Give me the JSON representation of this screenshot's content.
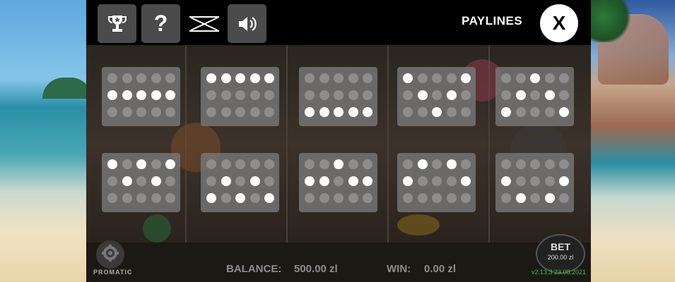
{
  "toolbar": {
    "trophy_icon": "trophy-icon",
    "help_label": "?",
    "turbo_icon": "turbo-off-icon",
    "sound_icon": "speaker-icon"
  },
  "panel": {
    "title": "PAYLINES",
    "close_label": "X"
  },
  "paylines": [
    {
      "rows": [
        [
          0,
          0,
          0,
          0,
          0
        ],
        [
          1,
          1,
          1,
          1,
          1
        ],
        [
          0,
          0,
          0,
          0,
          0
        ]
      ]
    },
    {
      "rows": [
        [
          1,
          1,
          1,
          1,
          1
        ],
        [
          0,
          0,
          0,
          0,
          0
        ],
        [
          0,
          0,
          0,
          0,
          0
        ]
      ]
    },
    {
      "rows": [
        [
          0,
          0,
          0,
          0,
          0
        ],
        [
          0,
          0,
          0,
          0,
          0
        ],
        [
          1,
          1,
          1,
          1,
          1
        ]
      ]
    },
    {
      "rows": [
        [
          1,
          0,
          0,
          0,
          1
        ],
        [
          0,
          1,
          0,
          1,
          0
        ],
        [
          0,
          0,
          1,
          0,
          0
        ]
      ]
    },
    {
      "rows": [
        [
          0,
          0,
          1,
          0,
          0
        ],
        [
          0,
          1,
          0,
          1,
          0
        ],
        [
          1,
          0,
          0,
          0,
          1
        ]
      ]
    },
    {
      "rows": [
        [
          1,
          0,
          1,
          0,
          1
        ],
        [
          0,
          1,
          0,
          1,
          0
        ],
        [
          0,
          0,
          0,
          0,
          0
        ]
      ]
    },
    {
      "rows": [
        [
          0,
          0,
          0,
          0,
          0
        ],
        [
          0,
          1,
          0,
          1,
          0
        ],
        [
          1,
          0,
          1,
          0,
          1
        ]
      ]
    },
    {
      "rows": [
        [
          0,
          0,
          1,
          0,
          0
        ],
        [
          1,
          1,
          0,
          1,
          1
        ],
        [
          0,
          0,
          0,
          0,
          0
        ]
      ]
    },
    {
      "rows": [
        [
          0,
          1,
          0,
          1,
          0
        ],
        [
          1,
          0,
          0,
          0,
          1
        ],
        [
          0,
          0,
          0,
          0,
          0
        ]
      ]
    },
    {
      "rows": [
        [
          0,
          0,
          0,
          0,
          0
        ],
        [
          1,
          0,
          0,
          0,
          1
        ],
        [
          0,
          1,
          0,
          1,
          0
        ]
      ]
    }
  ],
  "footer": {
    "balance_label": "BALANCE:",
    "balance_value": "500.00 zl",
    "win_label": "WIN:",
    "win_value": "0.00 zl",
    "bet_label": "BET",
    "bet_value": "200.00 zl",
    "version": "v2.13.3 23.08.2021",
    "logo_text": "PROMATIC"
  },
  "colors": {
    "dot_on": "#ffffff",
    "dot_off": "#8d8d8d",
    "panel_bg": "#787878",
    "version_green": "#39c23b"
  }
}
